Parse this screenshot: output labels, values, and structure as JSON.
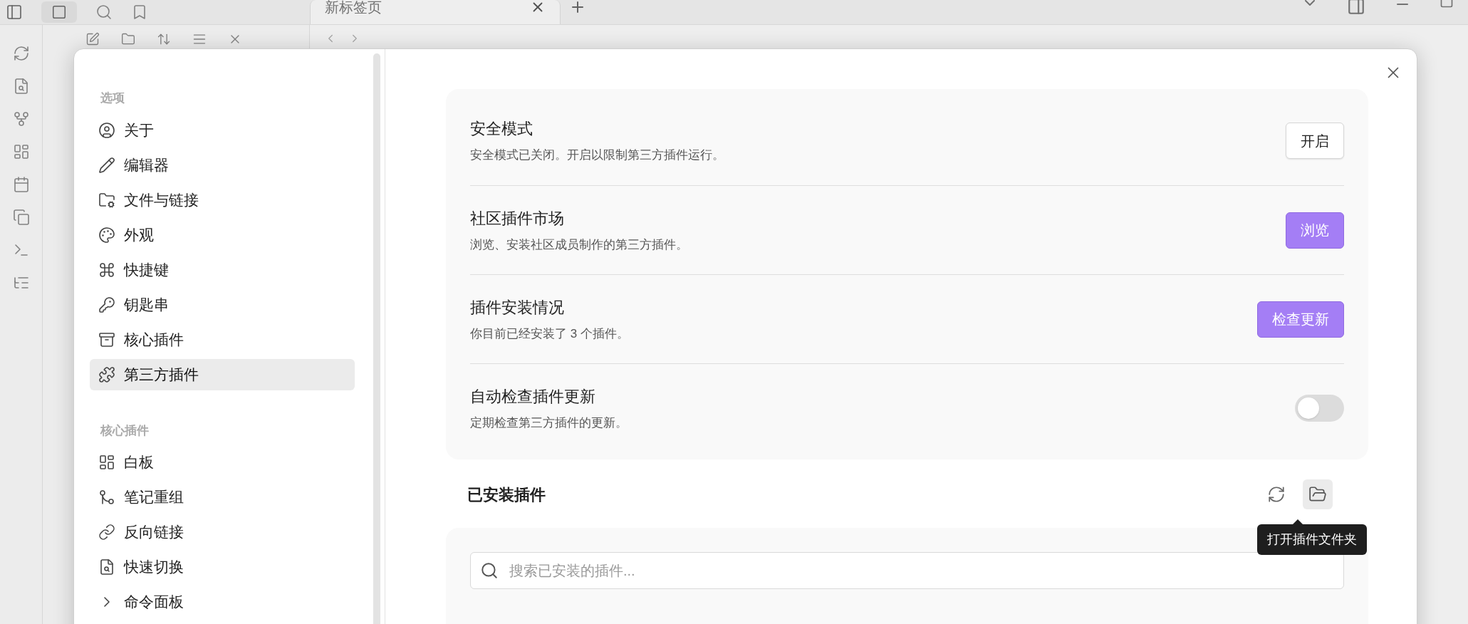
{
  "app": {
    "tab": {
      "label": "新标签页",
      "selected": true
    }
  },
  "settings": {
    "sidebar": {
      "sections": [
        {
          "heading": "选项",
          "items": [
            {
              "label": "关于",
              "selected": false
            },
            {
              "label": "编辑器",
              "selected": false
            },
            {
              "label": "文件与链接",
              "selected": false
            },
            {
              "label": "外观",
              "selected": false
            },
            {
              "label": "快捷键",
              "selected": false
            },
            {
              "label": "钥匙串",
              "selected": false
            },
            {
              "label": "核心插件",
              "selected": false
            },
            {
              "label": "第三方插件",
              "selected": true
            }
          ]
        },
        {
          "heading": "核心插件",
          "items": [
            {
              "label": "白板",
              "selected": false
            },
            {
              "label": "笔记重组",
              "selected": false
            },
            {
              "label": "反向链接",
              "selected": false
            },
            {
              "label": "快速切换",
              "selected": false
            },
            {
              "label": "命令面板",
              "selected": false
            }
          ]
        }
      ]
    },
    "options": [
      {
        "kind": "button",
        "title": "安全模式",
        "description": "安全模式已关闭。开启以限制第三方插件运行。",
        "button": {
          "label": "开启",
          "primary": false
        }
      },
      {
        "kind": "button",
        "title": "社区插件市场",
        "description": "浏览、安装社区成员制作的第三方插件。",
        "button": {
          "label": "浏览",
          "primary": true
        }
      },
      {
        "kind": "button",
        "title": "插件安装情况",
        "description": "你目前已经安装了 3 个插件。",
        "button": {
          "label": "检查更新",
          "primary": true
        }
      },
      {
        "kind": "toggle",
        "title": "自动检查插件更新",
        "description": "定期检查第三方插件的更新。",
        "on": false
      }
    ],
    "installed": {
      "heading": "已安装插件",
      "tooltip": "打开插件文件夹",
      "search": {
        "placeholder": "搜索已安装的插件..."
      }
    }
  }
}
